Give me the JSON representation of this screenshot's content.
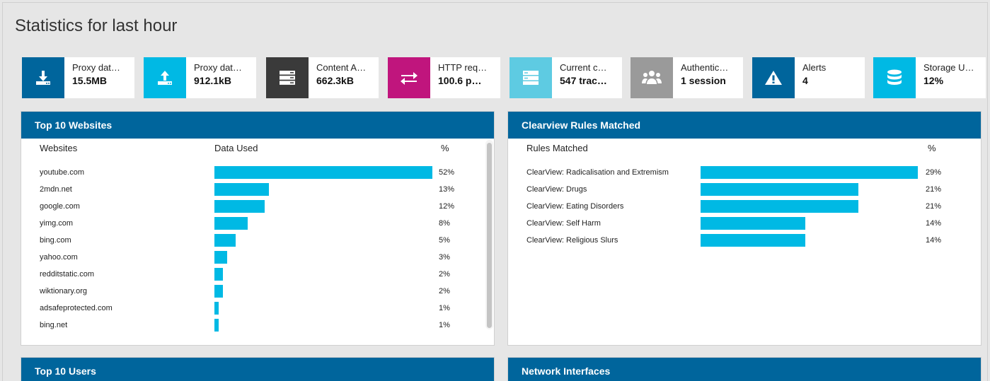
{
  "page": {
    "title": "Statistics for last hour"
  },
  "stats": [
    {
      "label": "Proxy dat…",
      "value": "15.5MB",
      "icon": "download-icon",
      "color": "#00659c"
    },
    {
      "label": "Proxy dat…",
      "value": "912.1kB",
      "icon": "upload-icon",
      "color": "#00b9e4"
    },
    {
      "label": "Content A…",
      "value": "662.3kB",
      "icon": "server-icon",
      "color": "#3a3a3a"
    },
    {
      "label": "HTTP req…",
      "value": "100.6 p…",
      "icon": "exchange-arrows-icon",
      "color": "#c0157d"
    },
    {
      "label": "Current c…",
      "value": "547 trac…",
      "icon": "server-stack-icon",
      "color": "#5ecbe2"
    },
    {
      "label": "Authentic…",
      "value": "1 session",
      "icon": "users-icon",
      "color": "#9a9a9a"
    },
    {
      "label": "Alerts",
      "value": "4",
      "icon": "warning-icon",
      "color": "#00659c"
    },
    {
      "label": "Storage U…",
      "value": "12%",
      "icon": "database-icon",
      "color": "#00b9e4"
    }
  ],
  "websites": {
    "title": "Top 10 Websites",
    "col_site": "Websites",
    "col_data": "Data Used",
    "col_pct": "%",
    "bar_color": "#00b9e4",
    "rows": [
      {
        "name": "youtube.com",
        "pct": "52%",
        "share": 0.52
      },
      {
        "name": "2mdn.net",
        "pct": "13%",
        "share": 0.13
      },
      {
        "name": "google.com",
        "pct": "12%",
        "share": 0.12
      },
      {
        "name": "yimg.com",
        "pct": "8%",
        "share": 0.08
      },
      {
        "name": "bing.com",
        "pct": "5%",
        "share": 0.05
      },
      {
        "name": "yahoo.com",
        "pct": "3%",
        "share": 0.03
      },
      {
        "name": "redditstatic.com",
        "pct": "2%",
        "share": 0.02
      },
      {
        "name": "wiktionary.org",
        "pct": "2%",
        "share": 0.02
      },
      {
        "name": "adsafeprotected.com",
        "pct": "1%",
        "share": 0.01
      },
      {
        "name": "bing.net",
        "pct": "1%",
        "share": 0.01
      }
    ]
  },
  "rules": {
    "title": "Clearview Rules Matched",
    "col_rule": "Rules Matched",
    "col_pct": "%",
    "bar_color": "#00b9e4",
    "rows": [
      {
        "name": "ClearView: Radicalisation and Extremism",
        "pct": "29%",
        "share": 0.29
      },
      {
        "name": "ClearView: Drugs",
        "pct": "21%",
        "share": 0.21
      },
      {
        "name": "ClearView: Eating Disorders",
        "pct": "21%",
        "share": 0.21
      },
      {
        "name": "ClearView: Self Harm",
        "pct": "14%",
        "share": 0.14
      },
      {
        "name": "ClearView: Religious Slurs",
        "pct": "14%",
        "share": 0.14
      }
    ]
  },
  "users": {
    "title": "Top 10 Users"
  },
  "network": {
    "title": "Network Interfaces"
  }
}
